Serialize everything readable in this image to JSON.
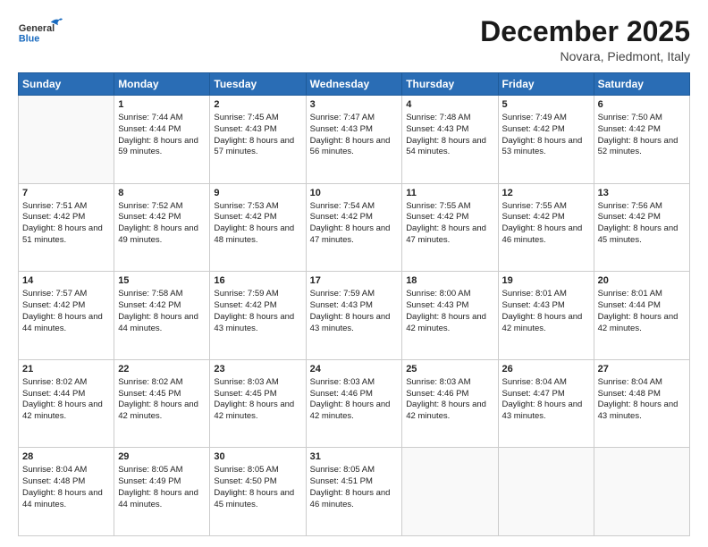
{
  "header": {
    "logo_general": "General",
    "logo_blue": "Blue",
    "month": "December 2025",
    "location": "Novara, Piedmont, Italy"
  },
  "days_of_week": [
    "Sunday",
    "Monday",
    "Tuesday",
    "Wednesday",
    "Thursday",
    "Friday",
    "Saturday"
  ],
  "weeks": [
    [
      {
        "day": "",
        "empty": true
      },
      {
        "day": "1",
        "sunrise": "Sunrise: 7:44 AM",
        "sunset": "Sunset: 4:44 PM",
        "daylight": "Daylight: 8 hours and 59 minutes."
      },
      {
        "day": "2",
        "sunrise": "Sunrise: 7:45 AM",
        "sunset": "Sunset: 4:43 PM",
        "daylight": "Daylight: 8 hours and 57 minutes."
      },
      {
        "day": "3",
        "sunrise": "Sunrise: 7:47 AM",
        "sunset": "Sunset: 4:43 PM",
        "daylight": "Daylight: 8 hours and 56 minutes."
      },
      {
        "day": "4",
        "sunrise": "Sunrise: 7:48 AM",
        "sunset": "Sunset: 4:43 PM",
        "daylight": "Daylight: 8 hours and 54 minutes."
      },
      {
        "day": "5",
        "sunrise": "Sunrise: 7:49 AM",
        "sunset": "Sunset: 4:42 PM",
        "daylight": "Daylight: 8 hours and 53 minutes."
      },
      {
        "day": "6",
        "sunrise": "Sunrise: 7:50 AM",
        "sunset": "Sunset: 4:42 PM",
        "daylight": "Daylight: 8 hours and 52 minutes."
      }
    ],
    [
      {
        "day": "7",
        "sunrise": "Sunrise: 7:51 AM",
        "sunset": "Sunset: 4:42 PM",
        "daylight": "Daylight: 8 hours and 51 minutes."
      },
      {
        "day": "8",
        "sunrise": "Sunrise: 7:52 AM",
        "sunset": "Sunset: 4:42 PM",
        "daylight": "Daylight: 8 hours and 49 minutes."
      },
      {
        "day": "9",
        "sunrise": "Sunrise: 7:53 AM",
        "sunset": "Sunset: 4:42 PM",
        "daylight": "Daylight: 8 hours and 48 minutes."
      },
      {
        "day": "10",
        "sunrise": "Sunrise: 7:54 AM",
        "sunset": "Sunset: 4:42 PM",
        "daylight": "Daylight: 8 hours and 47 minutes."
      },
      {
        "day": "11",
        "sunrise": "Sunrise: 7:55 AM",
        "sunset": "Sunset: 4:42 PM",
        "daylight": "Daylight: 8 hours and 47 minutes."
      },
      {
        "day": "12",
        "sunrise": "Sunrise: 7:55 AM",
        "sunset": "Sunset: 4:42 PM",
        "daylight": "Daylight: 8 hours and 46 minutes."
      },
      {
        "day": "13",
        "sunrise": "Sunrise: 7:56 AM",
        "sunset": "Sunset: 4:42 PM",
        "daylight": "Daylight: 8 hours and 45 minutes."
      }
    ],
    [
      {
        "day": "14",
        "sunrise": "Sunrise: 7:57 AM",
        "sunset": "Sunset: 4:42 PM",
        "daylight": "Daylight: 8 hours and 44 minutes."
      },
      {
        "day": "15",
        "sunrise": "Sunrise: 7:58 AM",
        "sunset": "Sunset: 4:42 PM",
        "daylight": "Daylight: 8 hours and 44 minutes."
      },
      {
        "day": "16",
        "sunrise": "Sunrise: 7:59 AM",
        "sunset": "Sunset: 4:42 PM",
        "daylight": "Daylight: 8 hours and 43 minutes."
      },
      {
        "day": "17",
        "sunrise": "Sunrise: 7:59 AM",
        "sunset": "Sunset: 4:43 PM",
        "daylight": "Daylight: 8 hours and 43 minutes."
      },
      {
        "day": "18",
        "sunrise": "Sunrise: 8:00 AM",
        "sunset": "Sunset: 4:43 PM",
        "daylight": "Daylight: 8 hours and 42 minutes."
      },
      {
        "day": "19",
        "sunrise": "Sunrise: 8:01 AM",
        "sunset": "Sunset: 4:43 PM",
        "daylight": "Daylight: 8 hours and 42 minutes."
      },
      {
        "day": "20",
        "sunrise": "Sunrise: 8:01 AM",
        "sunset": "Sunset: 4:44 PM",
        "daylight": "Daylight: 8 hours and 42 minutes."
      }
    ],
    [
      {
        "day": "21",
        "sunrise": "Sunrise: 8:02 AM",
        "sunset": "Sunset: 4:44 PM",
        "daylight": "Daylight: 8 hours and 42 minutes."
      },
      {
        "day": "22",
        "sunrise": "Sunrise: 8:02 AM",
        "sunset": "Sunset: 4:45 PM",
        "daylight": "Daylight: 8 hours and 42 minutes."
      },
      {
        "day": "23",
        "sunrise": "Sunrise: 8:03 AM",
        "sunset": "Sunset: 4:45 PM",
        "daylight": "Daylight: 8 hours and 42 minutes."
      },
      {
        "day": "24",
        "sunrise": "Sunrise: 8:03 AM",
        "sunset": "Sunset: 4:46 PM",
        "daylight": "Daylight: 8 hours and 42 minutes."
      },
      {
        "day": "25",
        "sunrise": "Sunrise: 8:03 AM",
        "sunset": "Sunset: 4:46 PM",
        "daylight": "Daylight: 8 hours and 42 minutes."
      },
      {
        "day": "26",
        "sunrise": "Sunrise: 8:04 AM",
        "sunset": "Sunset: 4:47 PM",
        "daylight": "Daylight: 8 hours and 43 minutes."
      },
      {
        "day": "27",
        "sunrise": "Sunrise: 8:04 AM",
        "sunset": "Sunset: 4:48 PM",
        "daylight": "Daylight: 8 hours and 43 minutes."
      }
    ],
    [
      {
        "day": "28",
        "sunrise": "Sunrise: 8:04 AM",
        "sunset": "Sunset: 4:48 PM",
        "daylight": "Daylight: 8 hours and 44 minutes."
      },
      {
        "day": "29",
        "sunrise": "Sunrise: 8:05 AM",
        "sunset": "Sunset: 4:49 PM",
        "daylight": "Daylight: 8 hours and 44 minutes."
      },
      {
        "day": "30",
        "sunrise": "Sunrise: 8:05 AM",
        "sunset": "Sunset: 4:50 PM",
        "daylight": "Daylight: 8 hours and 45 minutes."
      },
      {
        "day": "31",
        "sunrise": "Sunrise: 8:05 AM",
        "sunset": "Sunset: 4:51 PM",
        "daylight": "Daylight: 8 hours and 46 minutes."
      },
      {
        "day": "",
        "empty": true
      },
      {
        "day": "",
        "empty": true
      },
      {
        "day": "",
        "empty": true
      }
    ]
  ]
}
